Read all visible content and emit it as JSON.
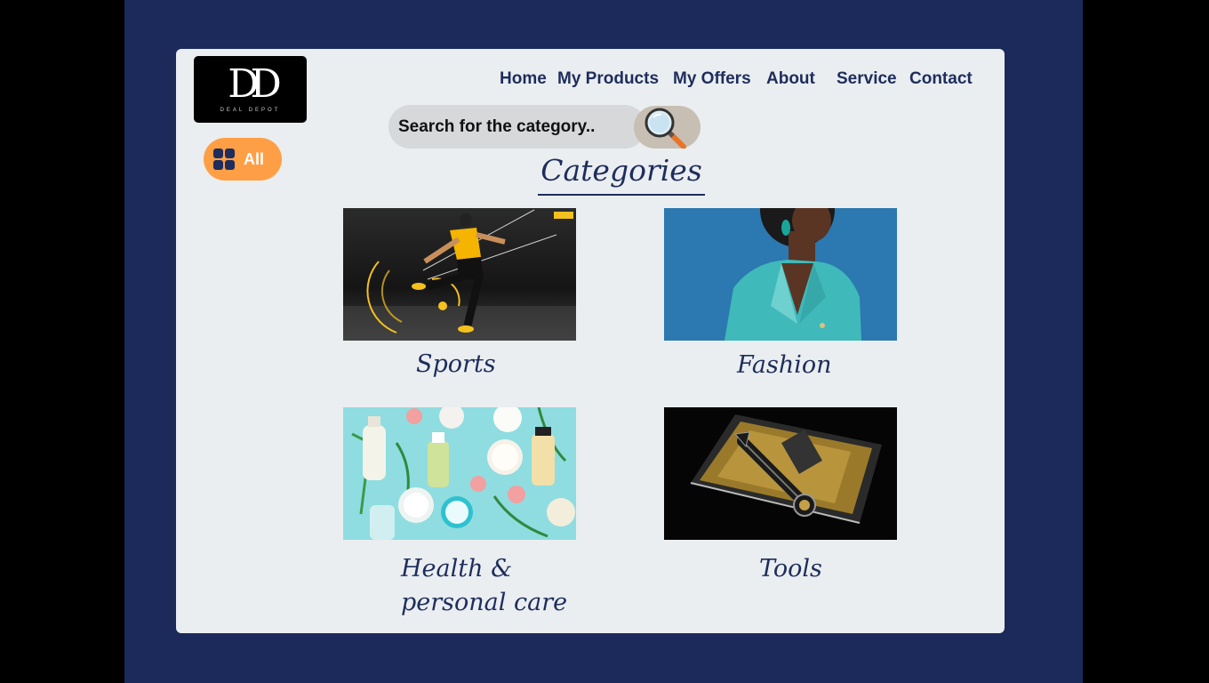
{
  "logo": {
    "mark": "DD",
    "subtitle": "DEAL DEPOT"
  },
  "nav": {
    "home": "Home",
    "products": "My Products",
    "offers": "My Offers",
    "about": "About",
    "service": "Service",
    "contact": "Contact"
  },
  "filter": {
    "all_label": "All",
    "icon": "grid-icon"
  },
  "search": {
    "placeholder": "Search for the category..",
    "icon": "magnifier-icon"
  },
  "page": {
    "title": "Categories"
  },
  "categories": [
    {
      "label": "Sports",
      "image": "soccer-player-photo"
    },
    {
      "label": "Fashion",
      "image": "woman-teal-blazer-photo"
    },
    {
      "label_line1": "Health &",
      "label_line2": "personal care",
      "image": "skincare-products-photo"
    },
    {
      "label": "Tools",
      "image": "wrench-tool-photo"
    }
  ],
  "colors": {
    "frame": "#1b2a5a",
    "card": "#eaeef0",
    "accent": "#ff9f45",
    "text": "#1e2d5c"
  }
}
